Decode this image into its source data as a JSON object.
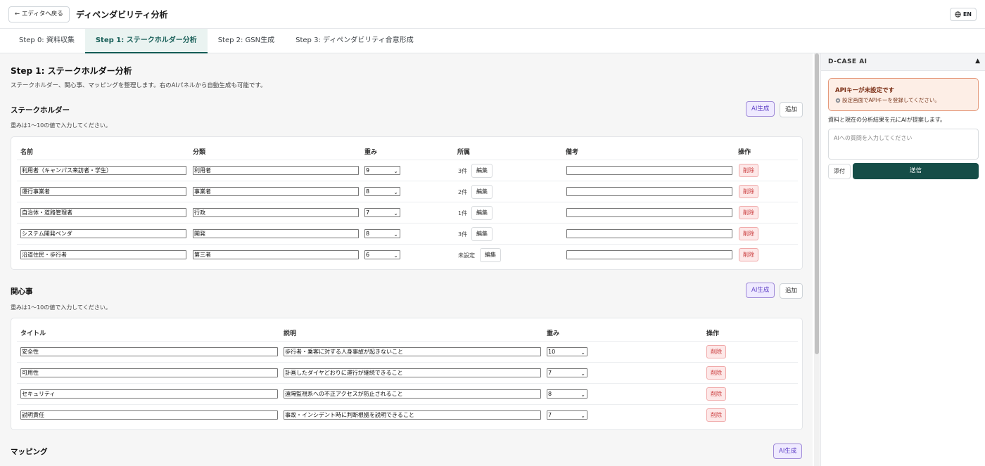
{
  "header": {
    "back_label": "← エディタへ戻る",
    "title": "ディペンダビリティ分析",
    "lang_label": "EN"
  },
  "tabs": [
    {
      "label": "Step 0: 資料収集"
    },
    {
      "label": "Step 1: ステークホルダー分析"
    },
    {
      "label": "Step 2: GSN生成"
    },
    {
      "label": "Step 3: ディペンダビリティ合意形成"
    }
  ],
  "step": {
    "title": "Step 1: ステークホルダー分析",
    "description": "ステークホルダー、関心事、マッピングを整理します。右のAIパネルから自動生成も可能です。"
  },
  "stakeholders": {
    "title": "ステークホルダー",
    "note": "重みは1〜10の値で入力してください。",
    "ai_label": "AI生成",
    "add_label": "追加",
    "headers": {
      "name": "名前",
      "category": "分類",
      "weight": "重み",
      "affiliation": "所属",
      "remarks": "備考",
      "actions": "操作"
    },
    "edit_label": "編集",
    "delete_label": "削除",
    "rows": [
      {
        "name": "利用者（キャンパス来訪者・学生）",
        "category": "利用者",
        "weight": "9",
        "affiliation": "3件",
        "remarks": ""
      },
      {
        "name": "運行事業者",
        "category": "事業者",
        "weight": "8",
        "affiliation": "2件",
        "remarks": ""
      },
      {
        "name": "自治体・道路管理者",
        "category": "行政",
        "weight": "7",
        "affiliation": "1件",
        "remarks": ""
      },
      {
        "name": "システム開発ベンダ",
        "category": "開発",
        "weight": "8",
        "affiliation": "3件",
        "remarks": ""
      },
      {
        "name": "沿道住民・歩行者",
        "category": "第三者",
        "weight": "6",
        "affiliation": "未設定",
        "remarks": ""
      }
    ]
  },
  "concerns": {
    "title": "関心事",
    "note": "重みは1〜10の値で入力してください。",
    "ai_label": "AI生成",
    "add_label": "追加",
    "headers": {
      "title": "タイトル",
      "description": "説明",
      "weight": "重み",
      "actions": "操作"
    },
    "delete_label": "削除",
    "rows": [
      {
        "title": "安全性",
        "description": "歩行者・乗客に対する人身事故が起きないこと",
        "weight": "10"
      },
      {
        "title": "可用性",
        "description": "計画したダイヤどおりに運行が継続できること",
        "weight": "7"
      },
      {
        "title": "セキュリティ",
        "description": "遠隔監視系への不正アクセスが防止されること",
        "weight": "8"
      },
      {
        "title": "説明責任",
        "description": "事故・インシデント時に判断根拠を説明できること",
        "weight": "7"
      }
    ]
  },
  "mapping": {
    "title": "マッピング",
    "ai_label": "AI生成"
  },
  "ai_panel": {
    "title": "D-CASE AI",
    "toggle": "▲",
    "warning_title": "APIキーが未設定です",
    "warning_sub": "設定画面でAPIキーを登録してください。",
    "description": "資料と現在の分析結果を元にAIが提案します。",
    "input_placeholder": "AIへの質問を入力してください",
    "attach_label": "添付",
    "send_label": "送信"
  }
}
